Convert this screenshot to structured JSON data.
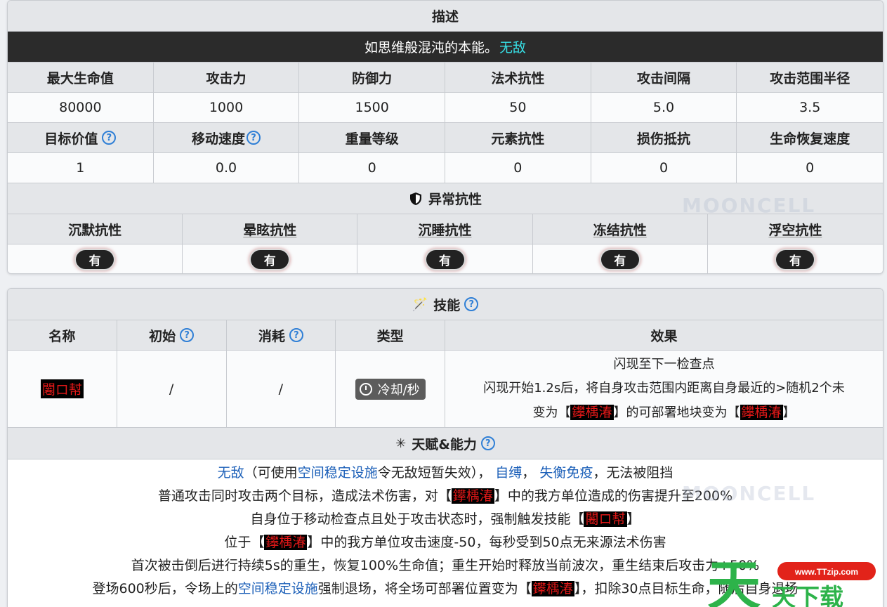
{
  "description": {
    "header": "描述",
    "text": "如思维般混沌的本能。",
    "tag": "无敌"
  },
  "stats": {
    "headers_1": [
      "最大生命值",
      "攻击力",
      "防御力",
      "法术抗性",
      "攻击间隔",
      "攻击范围半径"
    ],
    "values_1": [
      "80000",
      "1000",
      "1500",
      "50",
      "5.0",
      "3.5"
    ],
    "headers_2": [
      "目标价值",
      "移动速度",
      "重量等级",
      "元素抗性",
      "损伤抵抗",
      "生命恢复速度"
    ],
    "values_2": [
      "1",
      "0.0",
      "0",
      "0",
      "0",
      "0"
    ]
  },
  "abnormal": {
    "header": "异常抗性",
    "headers": [
      "沉默抗性",
      "晕眩抗性",
      "沉睡抗性",
      "冻结抗性",
      "浮空抗性"
    ],
    "values": [
      "有",
      "有",
      "有",
      "有",
      "有"
    ]
  },
  "skills": {
    "header": "技能",
    "columns": [
      "名称",
      "初始",
      "消耗",
      "类型",
      "效果"
    ],
    "row": {
      "name": "闂ロ幇",
      "initial": "/",
      "cost": "/",
      "type": "冷却/秒",
      "effect_1": "闪现至下一检查点",
      "effect_2": "闪现开始1.2s后，将自身攻击范围内距离自身最近的>随机2个未",
      "effect_3a": "变为【",
      "effect_3b": "鑻楀湷",
      "effect_3c": "】的可部署地块变为【",
      "effect_3d": "鑻楀湷",
      "effect_3e": "】"
    }
  },
  "talents": {
    "header": "天赋&能力",
    "line1": {
      "a": "无敌",
      "b": "（可使用",
      "c": "空间稳定设施",
      "d": "令无敌短暂失效）， ",
      "e": "自缚",
      "f": "， ",
      "g": "失衡免疫",
      "h": "，无法被阻挡"
    },
    "line2": {
      "a": "普通攻击同时攻击两个目标，造成法术伤害，对【",
      "b": "鑻楀湷",
      "c": "】中的我方单位造成的伤害提升至200%"
    },
    "line3": {
      "a": "自身位于移动检查点且处于攻击状态时，强制触发技能【",
      "b": "闂ロ幇",
      "c": "】"
    },
    "line4": {
      "a": "位于【",
      "b": "鑻楀湷",
      "c": "】中的我方单位攻击速度-50，每秒受到50点无来源法术伤害"
    },
    "line5": {
      "a": "首次被击倒后进行持续5s的重生，恢复100%生命值；重生开始时释放当前波次，重生结束后攻击力+50%"
    },
    "line6": {
      "a": "登场600秒后，令场上的",
      "b": "空间稳定设施",
      "c": "强制退场，将全场可部署位置变为【",
      "d": "鑻楀湷",
      "e": "】，扣除30点目标生命，随后自身退场"
    }
  },
  "watermark": "MOONCELL",
  "overlay": {
    "site": "www.TTzip.com",
    "logo_text": "天下载"
  }
}
